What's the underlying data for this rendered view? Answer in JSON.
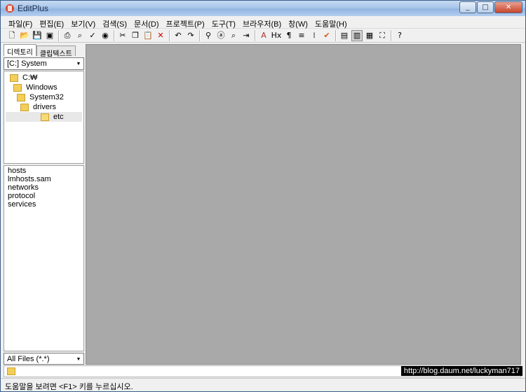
{
  "window": {
    "title": "EditPlus",
    "minimize": "_",
    "maximize": "□",
    "close": "✕"
  },
  "menu": [
    "파일(F)",
    "편집(E)",
    "보기(V)",
    "검색(S)",
    "문서(D)",
    "프로젝트(P)",
    "도구(T)",
    "브라우저(B)",
    "창(W)",
    "도움말(H)"
  ],
  "toolbar": [
    {
      "icon": "new-file-icon",
      "glyph": "🗋"
    },
    {
      "icon": "open-icon",
      "glyph": "📂"
    },
    {
      "icon": "save-icon",
      "glyph": "💾"
    },
    {
      "icon": "save-all-icon",
      "glyph": "▣"
    },
    {
      "sep": true
    },
    {
      "icon": "print-icon",
      "glyph": "⎙"
    },
    {
      "icon": "print-preview-icon",
      "glyph": "⌕"
    },
    {
      "icon": "spell-check-icon",
      "glyph": "✓"
    },
    {
      "icon": "browser-icon",
      "glyph": "◉"
    },
    {
      "sep": true
    },
    {
      "icon": "cut-icon",
      "glyph": "✂"
    },
    {
      "icon": "copy-icon",
      "glyph": "❐"
    },
    {
      "icon": "paste-icon",
      "glyph": "📋"
    },
    {
      "icon": "delete-icon",
      "glyph": "✕",
      "color": "#cc0000"
    },
    {
      "sep": true
    },
    {
      "icon": "undo-icon",
      "glyph": "↶"
    },
    {
      "icon": "redo-icon",
      "glyph": "↷"
    },
    {
      "sep": true
    },
    {
      "icon": "find-icon",
      "glyph": "⚲"
    },
    {
      "icon": "replace-icon",
      "glyph": "ⓐ"
    },
    {
      "icon": "find-in-files-icon",
      "glyph": "⌕"
    },
    {
      "icon": "goto-icon",
      "glyph": "⇥"
    },
    {
      "sep": true
    },
    {
      "icon": "font-icon",
      "glyph": "A",
      "color": "#b03030"
    },
    {
      "icon": "hex-icon",
      "glyph": "Hx"
    },
    {
      "icon": "paragraph-icon",
      "glyph": "¶"
    },
    {
      "icon": "word-wrap-icon",
      "glyph": "≡"
    },
    {
      "icon": "ruler-icon",
      "glyph": "⁞"
    },
    {
      "icon": "check-icon",
      "glyph": "✔",
      "color": "#e0581a"
    },
    {
      "sep": true
    },
    {
      "icon": "output-window-icon",
      "glyph": "▤"
    },
    {
      "icon": "directory-window-icon",
      "glyph": "▥",
      "pressed": true
    },
    {
      "icon": "cliptext-window-icon",
      "glyph": "▦"
    },
    {
      "icon": "full-screen-icon",
      "glyph": "⛶"
    },
    {
      "sep": true
    },
    {
      "icon": "help-icon",
      "glyph": "?"
    }
  ],
  "left_panel": {
    "tabs": [
      "디렉토리",
      "클립텍스트"
    ],
    "drive": "[C:] System",
    "tree": [
      {
        "label": "C:₩",
        "indent": 0
      },
      {
        "label": "Windows",
        "indent": 1
      },
      {
        "label": "System32",
        "indent": 2
      },
      {
        "label": "drivers",
        "indent": 3
      },
      {
        "label": "etc",
        "indent": 4,
        "selected": true
      }
    ],
    "files": [
      "hosts",
      "lmhosts.sam",
      "networks",
      "protocol",
      "services"
    ],
    "filter": "All Files (*.*)"
  },
  "watermark": "http://blog.daum.net/luckyman717",
  "status": "도움말을 보려면 <F1> 키를 누르십시오."
}
